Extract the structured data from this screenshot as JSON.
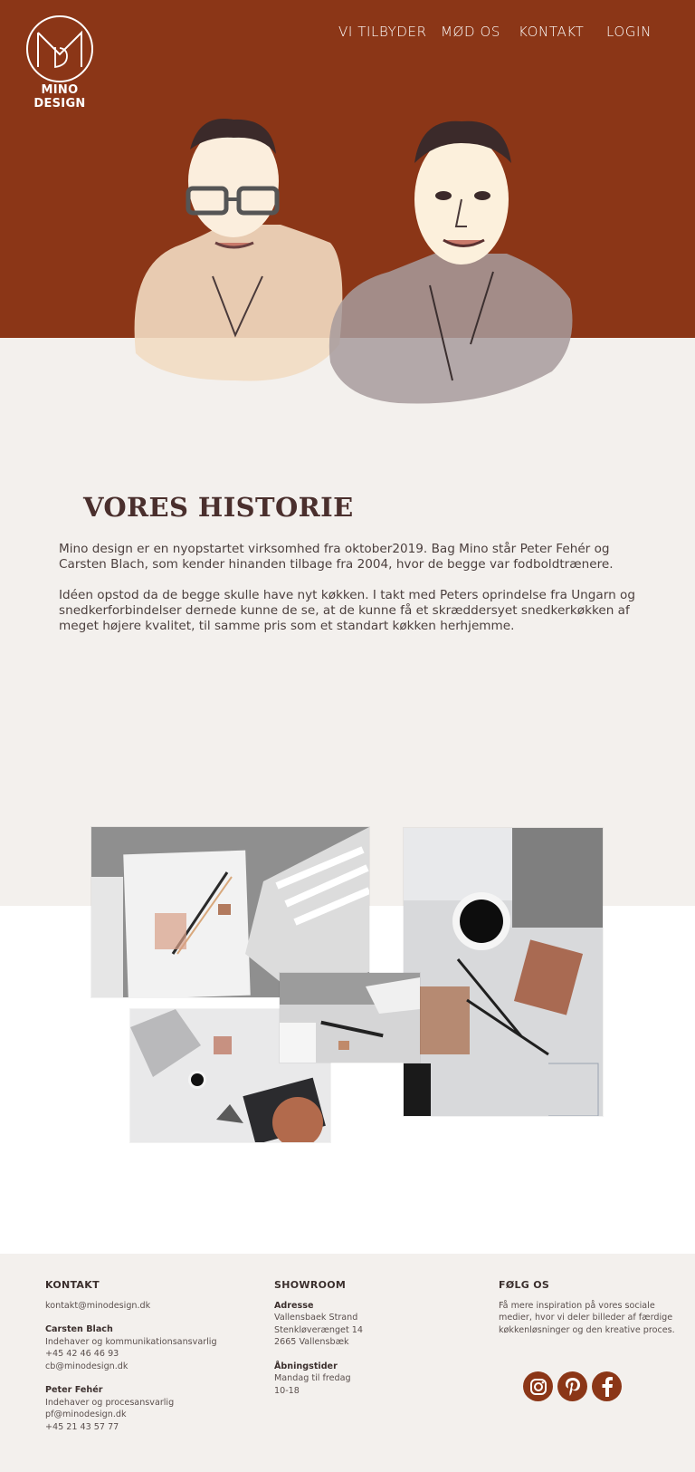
{
  "brand": {
    "name": "MINO DESIGN"
  },
  "nav": {
    "items": [
      {
        "label": "VI TILBYDER"
      },
      {
        "label": "MØD OS"
      },
      {
        "label": "KONTAKT"
      },
      {
        "label": "LOGIN"
      }
    ]
  },
  "story": {
    "title": "VORES HISTORIE",
    "paragraphs": [
      "Mino design er en nyopstartet virksomhed fra oktober2019. Bag Mino står Peter Fehér og Carsten Blach, som kender hinanden tilbage fra 2004, hvor de begge var fodboldtrænere.",
      "Idéen opstod da de begge skulle have nyt køkken.  I takt med Peters oprindelse fra Ungarn og snedkerforbindelser dernede kunne de se, at de kunne få et skræddersyet snedkerkøkken af meget højere kvalitet, til samme pris som et standart køkken herhjemme."
    ]
  },
  "footer": {
    "kontakt": {
      "heading": "KONTAKT",
      "email": "kontakt@minodesign.dk",
      "people": [
        {
          "name": "Carsten Blach",
          "role": "Indehaver og kommunikationsansvarlig",
          "lines": [
            "+45 42 46 46 93",
            "cb@minodesign.dk"
          ]
        },
        {
          "name": "Peter Fehér",
          "role": "Indehaver og procesansvarlig",
          "lines": [
            "pf@minodesign.dk",
            "+45 21 43 57 77"
          ]
        }
      ]
    },
    "showroom": {
      "heading": "SHOWROOM",
      "address_label": "Adresse",
      "address": [
        "Vallensbaek Strand",
        "Stenkløverænget 14",
        "2665 Vallensbæk"
      ],
      "hours_label": "Åbningstider",
      "hours": [
        "Mandag til fredag",
        "10-18"
      ]
    },
    "follow": {
      "heading": "FØLG OS",
      "text": "Få mere inspiration på vores sociale medier, hvor vi deler billeder af færdige køkkenløsninger og den kreative proces.",
      "icons": [
        "instagram-icon",
        "pinterest-icon",
        "facebook-icon"
      ]
    }
  },
  "colors": {
    "accent": "#8b3617",
    "background": "#f3f0ed",
    "text": "#4a3f3d"
  }
}
